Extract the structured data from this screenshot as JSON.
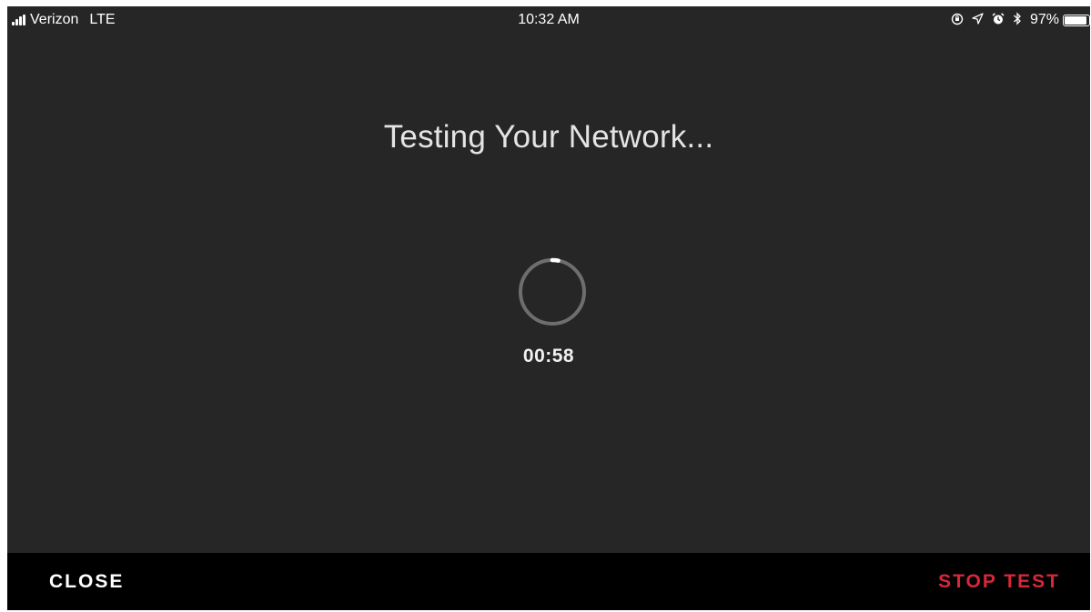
{
  "status_bar": {
    "carrier": "Verizon",
    "network": "LTE",
    "time": "10:32 AM",
    "battery_percent": "97%",
    "battery_level": 0.97,
    "icons": [
      "signal-icon",
      "lock-rotation-icon",
      "location-icon",
      "alarm-icon",
      "bluetooth-icon",
      "battery-icon"
    ]
  },
  "main": {
    "title": "Testing Your Network...",
    "timer": "00:58",
    "spinner_progress": 0.03
  },
  "bottom_bar": {
    "close_label": "CLOSE",
    "stop_label": "STOP TEST"
  },
  "colors": {
    "background": "#262626",
    "bottom_bar": "#000000",
    "accent_red": "#d6283a",
    "text": "#e4e4e4"
  }
}
